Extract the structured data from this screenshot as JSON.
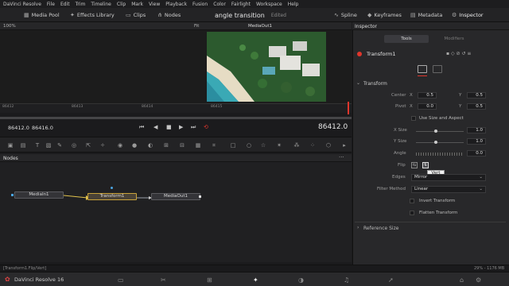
{
  "menu": [
    "DaVinci Resolve",
    "File",
    "Edit",
    "Trim",
    "Timeline",
    "Clip",
    "Mark",
    "View",
    "Playback",
    "Fusion",
    "Color",
    "Fairlight",
    "Workspace",
    "Help"
  ],
  "toolbar": {
    "media_pool": "Media Pool",
    "effects_library": "Effects Library",
    "clips": "Clips",
    "nodes": "Nodes",
    "project_title": "angle transition",
    "edited": "Edited",
    "spline": "Spline",
    "keyframes": "Keyframes",
    "metadata": "Metadata",
    "inspector": "Inspector"
  },
  "viewer": {
    "zoom": "100%",
    "fit": "Fit",
    "output_name": "MediaOut1",
    "ruler_ticks": [
      "86412",
      "86413",
      "86414",
      "86415"
    ],
    "tc_start": "86412.0",
    "tc_end": "86416.0",
    "tc_current": "86412.0"
  },
  "nodes": {
    "header": "Nodes",
    "media_in": "MediaIn1",
    "transform": "Transform1",
    "media_out": "MediaOut1"
  },
  "status": {
    "left": "[Transform1.Flip/Vert]",
    "right": "29% - 1176 MB"
  },
  "app_name": "DaVinci Resolve 16",
  "inspector": {
    "header": "Inspector",
    "tab_tools": "Tools",
    "tab_modifiers": "Modifiers",
    "tool_name": "Transform1",
    "section": "Transform",
    "center_label": "Center",
    "center_x": "0.5",
    "center_y": "0.5",
    "pivot_label": "Pivot",
    "pivot_x": "0.0",
    "pivot_y": "0.5",
    "x_label": "X",
    "y_label": "Y",
    "use_size_aspect": "Use Size and Aspect",
    "xsize_label": "X Size",
    "xsize": "1.0",
    "ysize_label": "Y Size",
    "ysize": "1.0",
    "angle_label": "Angle",
    "angle": "0.0",
    "flip_label": "Flip",
    "tooltip": "Vert",
    "edges_label": "Edges",
    "edges_value": "Mirror",
    "filter_label": "Filter Method",
    "filter_value": "Linear",
    "invert": "Invert Transform",
    "flatten": "Flatten Transform",
    "reference_size": "Reference Size"
  },
  "colors": {
    "accent_red": "#e0362c",
    "selected_node": "#c9a23a",
    "tab_active": "#3a3a3e"
  }
}
